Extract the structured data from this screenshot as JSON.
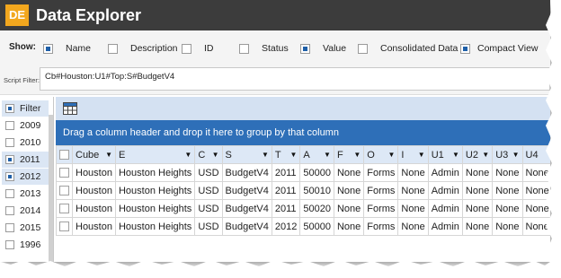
{
  "app": {
    "logo_text": "DE",
    "title": "Data Explorer"
  },
  "show": {
    "label": "Show:",
    "options": [
      {
        "label": "Name",
        "checked": true
      },
      {
        "label": "Description",
        "checked": false
      },
      {
        "label": "ID",
        "checked": false
      },
      {
        "label": "Status",
        "checked": false
      },
      {
        "label": "Value",
        "checked": true
      },
      {
        "label": "Consolidated Data",
        "checked": false
      },
      {
        "label": "Compact View",
        "checked": true
      }
    ]
  },
  "script_filter": {
    "label": "Script Filter:",
    "value": "Cb#Houston:U1#Top:S#BudgetV4"
  },
  "filter_panel": {
    "header": "Filter",
    "items": [
      {
        "label": "2009",
        "checked": false
      },
      {
        "label": "2010",
        "checked": false
      },
      {
        "label": "2011",
        "checked": true
      },
      {
        "label": "2012",
        "checked": true
      },
      {
        "label": "2013",
        "checked": false
      },
      {
        "label": "2014",
        "checked": false
      },
      {
        "label": "2015",
        "checked": false
      },
      {
        "label": "1996",
        "checked": false
      }
    ]
  },
  "grid": {
    "toolbar_icon": "grid-layout-icon",
    "group_hint": "Drag a column header and drop it here to group by that column",
    "columns": [
      "Cube",
      "E",
      "C",
      "S",
      "T",
      "A",
      "F",
      "O",
      "I",
      "U1",
      "U2",
      "U3",
      "U4"
    ],
    "rows": [
      [
        "Houston",
        "Houston Heights",
        "USD",
        "BudgetV4",
        "2011",
        "50000",
        "None",
        "Forms",
        "None",
        "Admin",
        "None",
        "None",
        "None"
      ],
      [
        "Houston",
        "Houston Heights",
        "USD",
        "BudgetV4",
        "2011",
        "50010",
        "None",
        "Forms",
        "None",
        "Admin",
        "None",
        "None",
        "None"
      ],
      [
        "Houston",
        "Houston Heights",
        "USD",
        "BudgetV4",
        "2011",
        "50020",
        "None",
        "Forms",
        "None",
        "Admin",
        "None",
        "None",
        "None"
      ],
      [
        "Houston",
        "Houston Heights",
        "USD",
        "BudgetV4",
        "2012",
        "50000",
        "None",
        "Forms",
        "None",
        "Admin",
        "None",
        "None",
        "None"
      ]
    ]
  },
  "colors": {
    "title_bar": "#3c3c3c",
    "logo": "#f2a71e",
    "group_bar": "#2e6fb8",
    "header": "#dde8f6",
    "toolbar": "#d4e1f2"
  }
}
